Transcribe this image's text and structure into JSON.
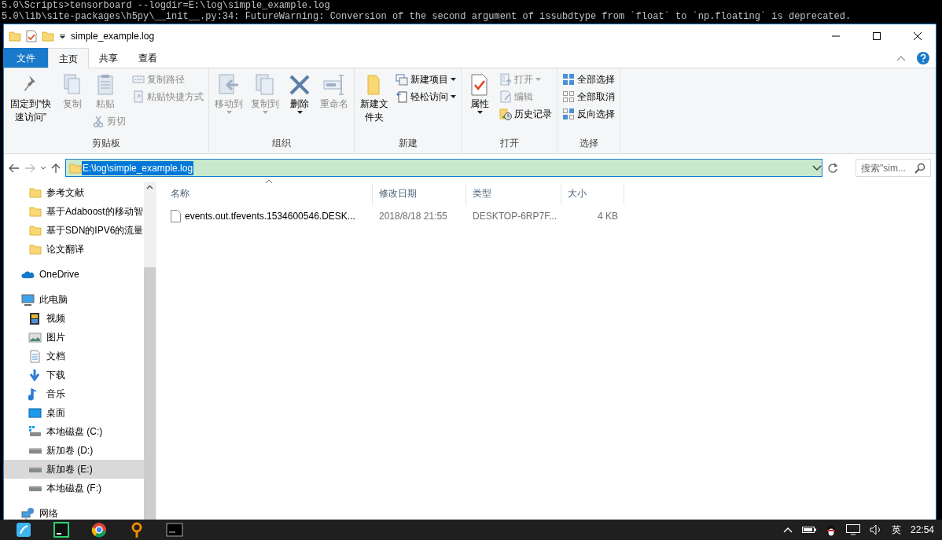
{
  "terminal": {
    "lines": [
      "5.0\\Scripts>tensorboard --logdir=E:\\log\\simple_example.log",
      "5.0\\lib\\site-packages\\h5py\\__init__.py:34: FutureWarning: Conversion of the second argument of issubdtype from `float` to `np.floating` is deprecated."
    ]
  },
  "window": {
    "title": "simple_example.log"
  },
  "tabs": [
    {
      "label": "文件",
      "kind": "file",
      "selected": false
    },
    {
      "label": "主页",
      "kind": "tab",
      "selected": true
    },
    {
      "label": "共享",
      "kind": "tab",
      "selected": false
    },
    {
      "label": "查看",
      "kind": "tab",
      "selected": false
    }
  ],
  "ribbon": {
    "groups": [
      {
        "label": "剪贴板",
        "columns": [
          [
            {
              "label": "固定到“快速访问”",
              "kind": "large",
              "disabled": false
            }
          ],
          [
            {
              "label": "复制",
              "kind": "large",
              "disabled": true
            }
          ],
          [
            {
              "label": "粘贴",
              "kind": "large",
              "disabled": true
            },
            {
              "label": "剪切",
              "kind": "small",
              "disabled": true
            }
          ],
          [
            {
              "label": "复制路径",
              "kind": "small",
              "disabled": true
            },
            {
              "label": "粘贴快捷方式",
              "kind": "small",
              "disabled": true
            }
          ]
        ]
      },
      {
        "label": "组织",
        "columns": [
          [
            {
              "label": "移动到",
              "kind": "large",
              "disabled": true,
              "dropdown": true
            }
          ],
          [
            {
              "label": "复制到",
              "kind": "large",
              "disabled": true,
              "dropdown": true
            }
          ],
          [
            {
              "label": "删除",
              "kind": "large",
              "disabled": false,
              "dropdown": true
            }
          ],
          [
            {
              "label": "重命名",
              "kind": "large",
              "disabled": true
            }
          ]
        ]
      },
      {
        "label": "新建",
        "columns": [
          [
            {
              "label": "新建文件夹",
              "kind": "large",
              "disabled": false
            }
          ],
          [
            {
              "label": "新建项目",
              "kind": "small",
              "disabled": false,
              "dropdown": true
            },
            {
              "label": "轻松访问",
              "kind": "small",
              "disabled": false,
              "dropdown": true
            }
          ]
        ]
      },
      {
        "label": "打开",
        "columns": [
          [
            {
              "label": "属性",
              "kind": "large",
              "disabled": false,
              "dropdown": true
            }
          ],
          [
            {
              "label": "打开",
              "kind": "small",
              "disabled": true,
              "dropdown": true
            },
            {
              "label": "编辑",
              "kind": "small",
              "disabled": true
            },
            {
              "label": "历史记录",
              "kind": "small",
              "disabled": false
            }
          ]
        ]
      },
      {
        "label": "选择",
        "columns": [
          [
            {
              "label": "全部选择",
              "kind": "small",
              "disabled": false
            },
            {
              "label": "全部取消",
              "kind": "small",
              "disabled": false
            },
            {
              "label": "反向选择",
              "kind": "small",
              "disabled": false
            }
          ]
        ]
      }
    ]
  },
  "address": {
    "path": "E:\\log\\simple_example.log",
    "selected": true
  },
  "search": {
    "placeholder": "搜索\"sim..."
  },
  "sidebar": {
    "quick_access_items": [
      {
        "label": "参考文献",
        "selected": false
      },
      {
        "label": "基于Adaboost的移动智",
        "selected": false
      },
      {
        "label": "基于SDN的IPV6的流量",
        "selected": false
      },
      {
        "label": "论文翻译",
        "selected": false
      }
    ],
    "items": [
      {
        "label": "OneDrive",
        "selected": false
      },
      {
        "label": "此电脑",
        "selected": false,
        "children": [
          {
            "label": "视频",
            "selected": false
          },
          {
            "label": "图片",
            "selected": false
          },
          {
            "label": "文档",
            "selected": false
          },
          {
            "label": "下载",
            "selected": false
          },
          {
            "label": "音乐",
            "selected": false
          },
          {
            "label": "桌面",
            "selected": false
          },
          {
            "label": "本地磁盘 (C:)",
            "selected": false
          },
          {
            "label": "新加卷 (D:)",
            "selected": false
          },
          {
            "label": "新加卷 (E:)",
            "selected": true
          },
          {
            "label": "本地磁盘 (F:)",
            "selected": false
          }
        ]
      },
      {
        "label": "网络",
        "selected": false
      }
    ]
  },
  "table": {
    "columns": [
      "名称",
      "修改日期",
      "类型",
      "大小"
    ],
    "rows": [
      {
        "cells": [
          "events.out.tfevents.1534600546.DESK...",
          "2018/8/18 21:55",
          "DESKTOP-6RP7F...",
          "4 KB"
        ],
        "selected": false
      }
    ]
  },
  "taskbar": {
    "tray_language": "英",
    "time": "22:54"
  }
}
